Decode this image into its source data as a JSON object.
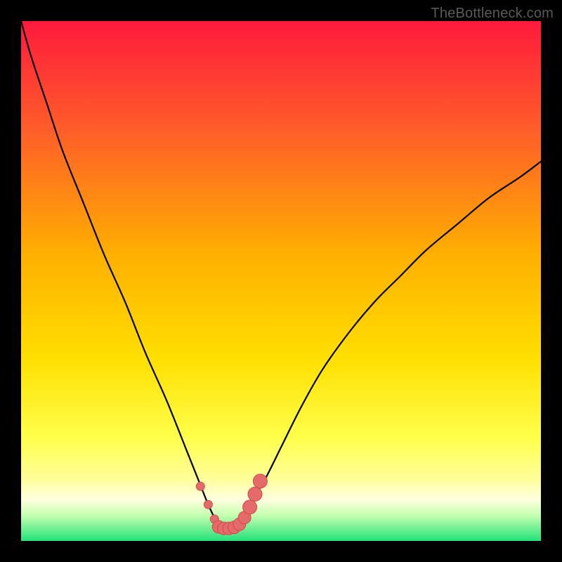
{
  "watermark": {
    "text": "TheBottleneck.com"
  },
  "colors": {
    "bg": "#000000",
    "grad_top": "#ff1a3c",
    "grad_upper": "#ff6a2a",
    "grad_mid": "#ffd400",
    "grad_lower_yellow": "#ffff66",
    "grad_pale": "#ffffcc",
    "grad_green": "#22e27a",
    "curve": "#000000",
    "marker_fill": "#e56a6a",
    "marker_stroke": "#d24a4a"
  },
  "chart_data": {
    "type": "line",
    "title": "",
    "xlabel": "",
    "ylabel": "",
    "xlim": [
      0,
      100
    ],
    "ylim": [
      0,
      100
    ],
    "x": [
      0,
      2,
      5,
      8,
      12,
      16,
      20,
      24,
      28,
      32,
      34,
      36,
      37.5,
      39,
      40.5,
      42,
      44,
      47,
      50,
      54,
      58,
      63,
      68,
      73,
      78,
      84,
      90,
      96,
      100
    ],
    "values": [
      100,
      93,
      84,
      75,
      65,
      55,
      46,
      36,
      27,
      17,
      12,
      7,
      4,
      2.5,
      2.5,
      4,
      7,
      12,
      18,
      26,
      33,
      40,
      46,
      51,
      56,
      61,
      66,
      70,
      73
    ],
    "markers_x": [
      34.5,
      36,
      37.2,
      38,
      39,
      40,
      41,
      42,
      43,
      44,
      45,
      46
    ],
    "markers_y": [
      10.5,
      7,
      4.2,
      2.7,
      2.4,
      2.4,
      2.6,
      3.2,
      4.5,
      6.5,
      9,
      11.5
    ],
    "annotations": []
  }
}
